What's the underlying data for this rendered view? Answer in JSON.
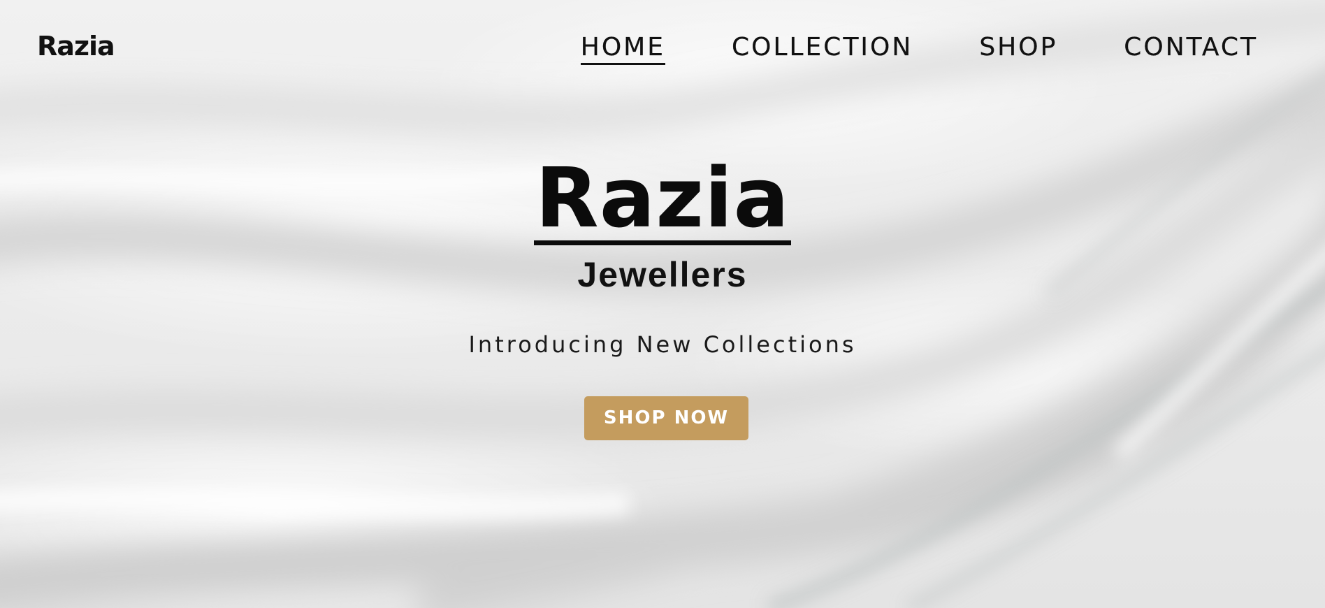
{
  "brand": {
    "logo_text": "Razia"
  },
  "nav": {
    "items": [
      {
        "label": "HOME",
        "active": true
      },
      {
        "label": "COLLECTION",
        "active": false
      },
      {
        "label": "SHOP",
        "active": false
      },
      {
        "label": "CONTACT",
        "active": false
      }
    ]
  },
  "hero": {
    "title": "Razia",
    "subtitle": "Jewellers",
    "tagline": "Introducing New Collections",
    "cta_label": "SHOP NOW"
  },
  "colors": {
    "accent": "#c49c5e",
    "text": "#111111",
    "background": "#eeeeee"
  }
}
